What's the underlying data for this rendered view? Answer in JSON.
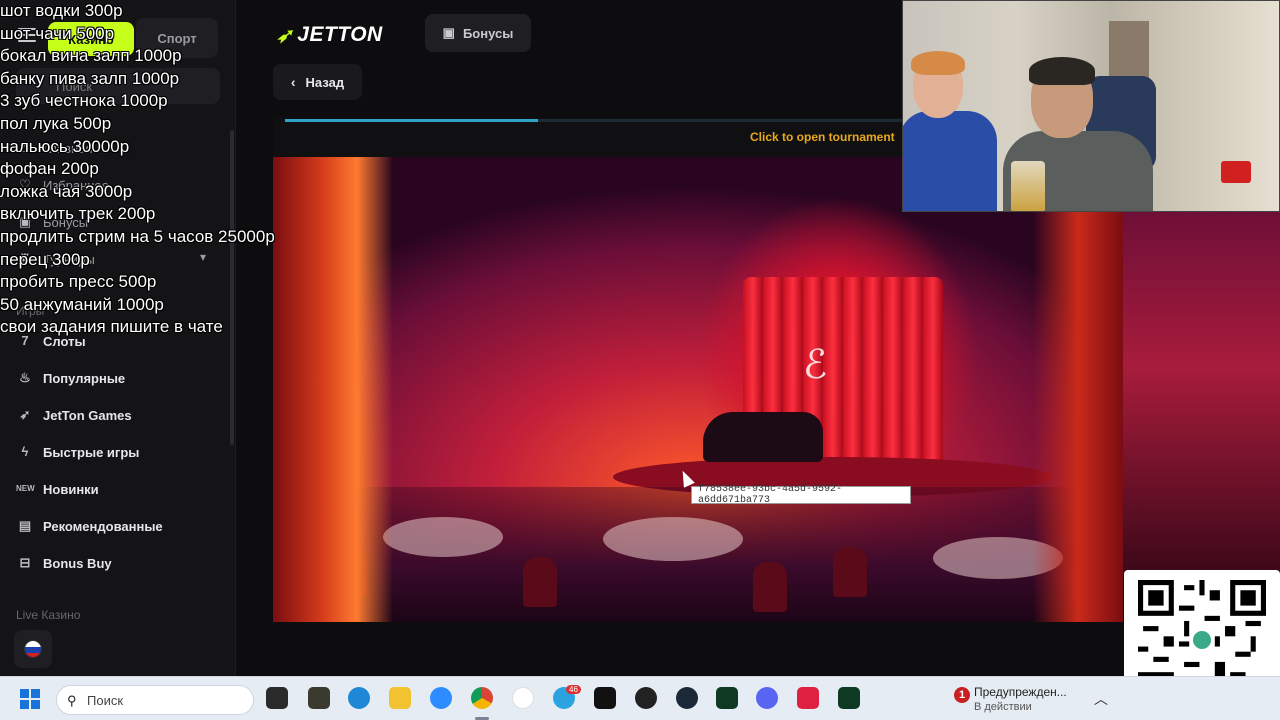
{
  "sidebar": {
    "tab_casino": "Казино",
    "tab_sport": "Спорт",
    "search_placeholder": "Поиск",
    "items_top": [
      {
        "label": "Главная",
        "icon": "home-icon"
      },
      {
        "label": "Избранное",
        "icon": "heart-icon"
      },
      {
        "label": "Бонусы",
        "icon": "gift-icon"
      },
      {
        "label": "Турниры",
        "icon": "trophy-icon"
      }
    ],
    "section_games": "Игры",
    "items_games": [
      {
        "label": "Слоты",
        "icon": "slots-icon"
      },
      {
        "label": "Популярные",
        "icon": "fire-icon"
      },
      {
        "label": "JetTon Games",
        "icon": "jet-icon"
      },
      {
        "label": "Быстрые игры",
        "icon": "lightning-icon"
      },
      {
        "label": "Новинки",
        "icon": "new-icon"
      },
      {
        "label": "Рекомендованные",
        "icon": "bookmark-icon"
      },
      {
        "label": "Bonus Buy",
        "icon": "bag-icon"
      }
    ],
    "section_live": "Live Казино"
  },
  "header": {
    "logo": "JETTON",
    "bonus_button": "Бонусы",
    "back_button": "Назад"
  },
  "game": {
    "tournament_text": "Click to open tournament",
    "progress": 0.41,
    "tooltip": "f78538ee-93bc-4a5d-9592-a6dd671ba773"
  },
  "overlay_lines": [
    "шот водки 300р",
    "шот чачи 500р",
    "бокал вина залп 1000р",
    "банку пива залп 1000р",
    "3 зуб честнока 1000р",
    "пол лука 500р",
    "нальюсь 30000р",
    "фофан 200р",
    "ложка чая 3000р",
    "включить трек 200р",
    "продлить стрим на 5 часов 25000р",
    "перец 300р",
    "пробить пресс 500р",
    "50 анжуманий 1000р",
    "свои задания пишите в чате"
  ],
  "taskbar": {
    "search_placeholder": "Поиск",
    "warning_title": "Предупрежден...",
    "warning_subtitle": "В действии",
    "telegram_badge": "46",
    "warning_badge": "1"
  },
  "colors": {
    "accent": "#c6ff1a",
    "tournament": "#e8a81c",
    "progress": "#2ea3c8"
  }
}
